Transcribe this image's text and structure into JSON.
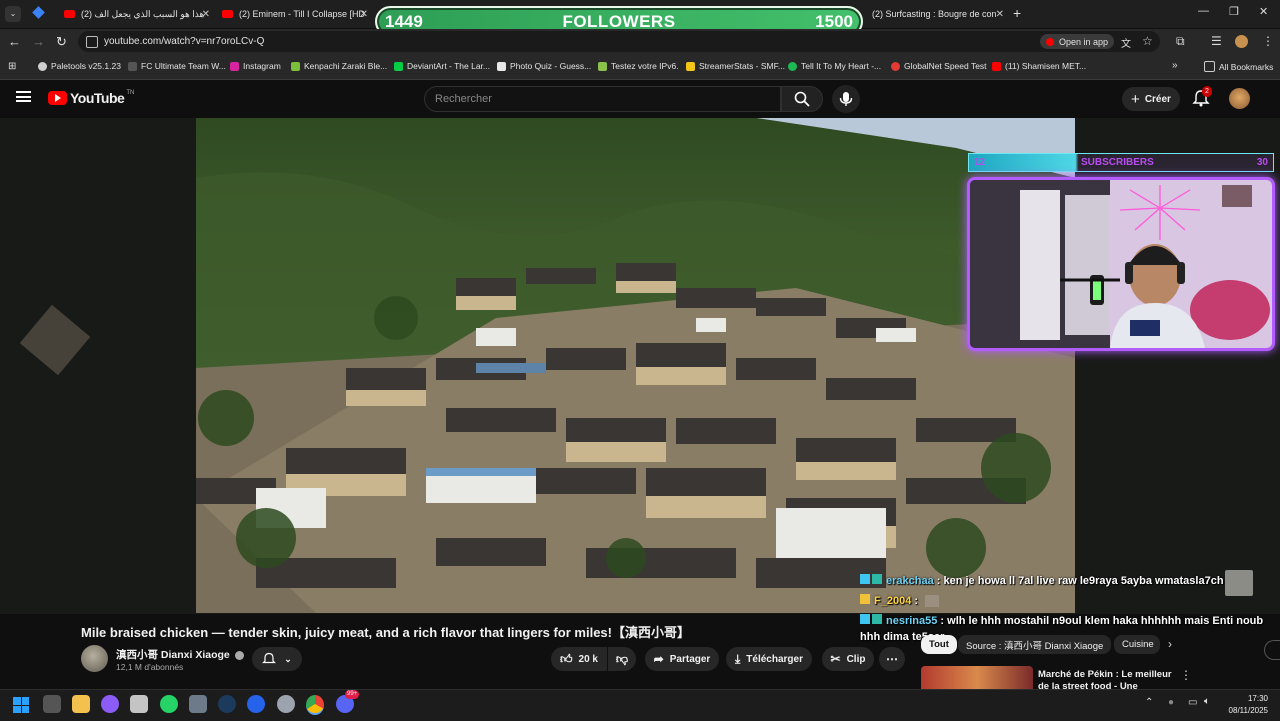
{
  "browser": {
    "tabs": [
      {
        "label": "هذا هو السبب الذي يجعل الف (2)"
      },
      {
        "label": "(2) Eminem - Till I Collapse [HD"
      },
      {
        "label": "(2) Surfcasting : Bougre de con"
      }
    ],
    "url": "youtube.com/watch?v=nr7oroLCv-Q",
    "open_in_app": "Open in app",
    "bookmarks": [
      {
        "label": "Paletools v25.1.23",
        "color": "#cfcfcf"
      },
      {
        "label": "FC Ultimate Team W...",
        "color": "#555555"
      },
      {
        "label": "Instagram",
        "color": "#d6249f"
      },
      {
        "label": "Kenpachi Zaraki Ble...",
        "color": "#7cbf3a"
      },
      {
        "label": "DeviantArt - The Lar...",
        "color": "#05cc47"
      },
      {
        "label": "Photo Quiz - Guess...",
        "color": "#e8e8e8"
      },
      {
        "label": "Testez votre IPv6.",
        "color": "#8bc34a"
      },
      {
        "label": "StreamerStats - SMF...",
        "color": "#f5c518"
      },
      {
        "label": "Tell It To My Heart -...",
        "color": "#1db954"
      },
      {
        "label": "GlobalNet Speed Test",
        "color": "#e53935"
      },
      {
        "label": "(11) Shamisen MET...",
        "color": "#ff0000"
      }
    ],
    "all_bookmarks": "All Bookmarks"
  },
  "followers_widget": {
    "current": "1449",
    "label": "FOLLOWERS",
    "goal": "1500"
  },
  "youtube": {
    "logo_text": "YouTube",
    "logo_sup": "TN",
    "search_placeholder": "Rechercher",
    "create_label": "Créer",
    "notif_count": "2"
  },
  "subscribers_widget": {
    "current": "12",
    "label": "SUBSCRIBERS",
    "goal": "30"
  },
  "chat": [
    {
      "user": "erakchaa",
      "text": " : ken je howa ll 7al live raw le9raya 5ayba wmatasla7ch"
    },
    {
      "user": "F_2004",
      "text": " :"
    },
    {
      "user": "nesrina55",
      "text": " : wlh le hhh mostahil n9oul klem haka hhhhhh mais Enti noub"
    },
    {
      "user": "",
      "text": "hhh dima te5ser"
    }
  ],
  "video": {
    "title": "Mile braised chicken — tender skin, juicy meat, and a rich flavor that lingers for miles!【滇西小哥】",
    "channel": "滇西小哥 Dianxi Xiaoge",
    "subscribers": "12,1 M d'abonnés",
    "likes": "20 k",
    "share": "Partager",
    "download": "Télécharger",
    "clip": "Clip"
  },
  "chips": [
    "Tout",
    "Source : 滇西小哥 Dianxi Xiaoge",
    "Cuisine"
  ],
  "recommended": {
    "title_line1": "Marché de Pékin : Le meilleur",
    "title_line2": "de la street food - Une"
  },
  "taskbar": {
    "time": "17:30",
    "date": "08/11/2025",
    "discord_badge": "99+"
  }
}
